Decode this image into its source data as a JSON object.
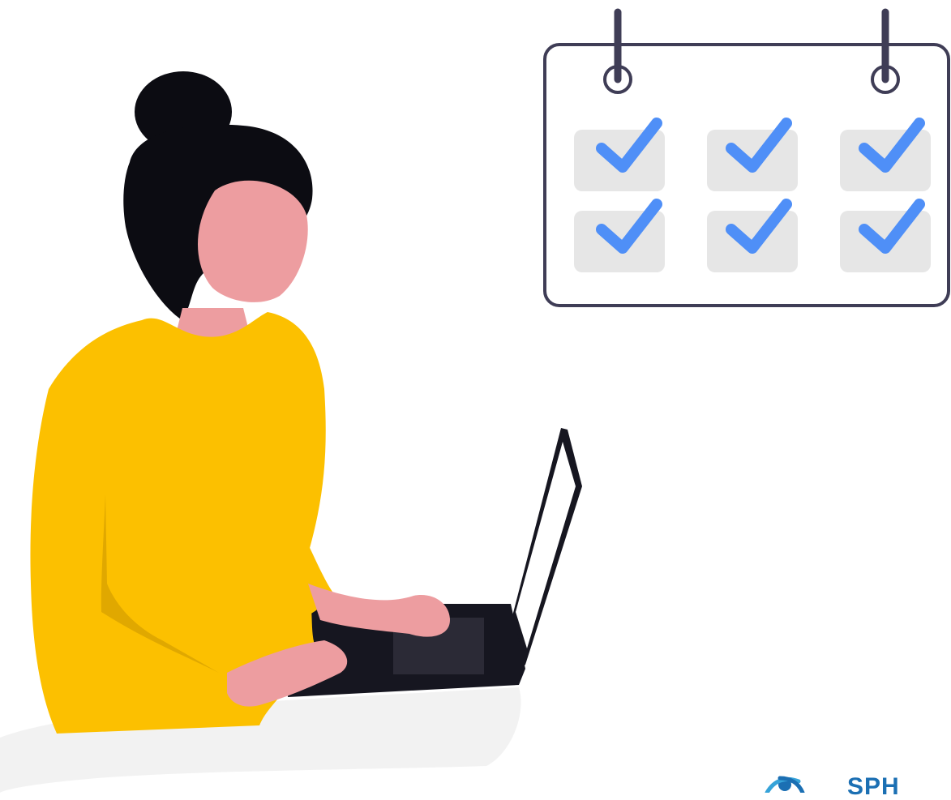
{
  "illustration": {
    "calendar": {
      "rows": 2,
      "columns": 3,
      "checked_cells": 6
    },
    "colors": {
      "background": "#ffffff",
      "sweater": "#fcc000",
      "sweater_shadow": "#e0a800",
      "skin": "#ed9da0",
      "hair": "#0c0c12",
      "laptop": "#161620",
      "calendar_frame": "#3f3d56",
      "calendar_cell": "#e6e6e6",
      "check": "#4f8ff7",
      "floor": "#f2f2f2"
    }
  },
  "logo": {
    "text": "SPH",
    "mark_icon": "sph-logo-mark-icon"
  }
}
